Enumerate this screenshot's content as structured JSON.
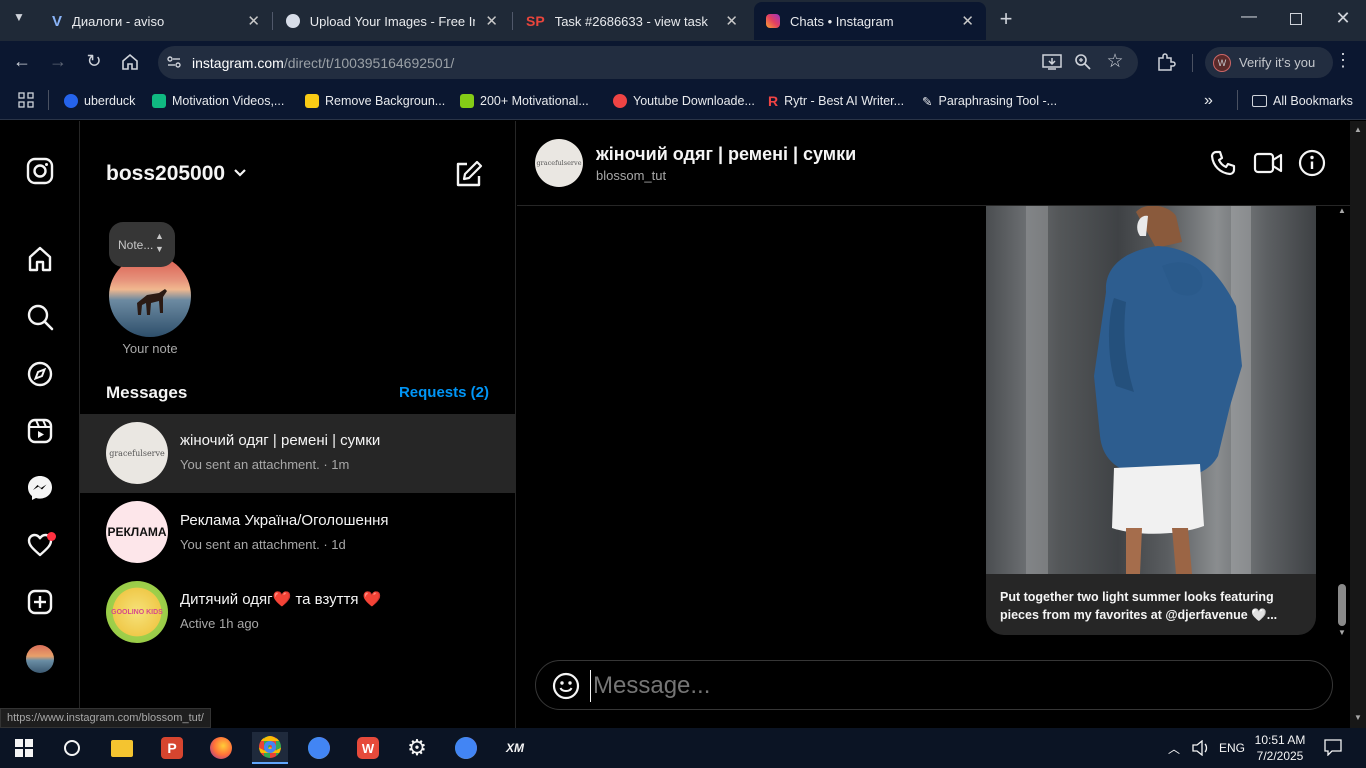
{
  "browser": {
    "tabs": [
      {
        "title": "Диалоги - aviso",
        "active": false
      },
      {
        "title": "Upload Your Images - Free Imag",
        "active": false
      },
      {
        "title": "Task #2686633 - view task",
        "active": false
      },
      {
        "title": "Chats • Instagram",
        "active": true
      }
    ],
    "url_host": "instagram.com",
    "url_path": "/direct/t/100395164692501/",
    "profile_button": "Verify it's you",
    "profile_initial": "W",
    "bookmarks": [
      "uberduck",
      "Motivation Videos,...",
      "Remove Backgroun...",
      "200+ Motivational...",
      "Youtube Downloade...",
      "Rytr - Best AI Writer...",
      "Paraphrasing Tool -..."
    ],
    "all_bookmarks": "All Bookmarks",
    "overflow": "»"
  },
  "sidebar": {
    "username": "boss205000",
    "note_label": "Note...",
    "your_note": "Your note",
    "messages_heading": "Messages",
    "requests": "Requests (2)",
    "conversations": [
      {
        "name": "жіночий одяг | ремені | сумки",
        "sub": "You sent an attachment. · 1m",
        "avatar_text": "gracefulserve"
      },
      {
        "name": "Реклама Україна/Оголошення",
        "sub": "You sent an attachment. · 1d",
        "avatar_text": "РЕКЛАМА"
      },
      {
        "name": "Дитячий одяг❤️ та взуття ❤️",
        "sub": "Active 1h ago",
        "avatar_text": "GOOLINO KIDS"
      }
    ]
  },
  "chat": {
    "title": "жіночий одяг | ремені | сумки",
    "handle": "blossom_tut",
    "header_avatar_text": "gracefulserve",
    "post_caption": "Put together two light summer looks featuring pieces from my favorites at @djerfavenue 🤍...",
    "message_placeholder": "Message..."
  },
  "status_url": "https://www.instagram.com/blossom_tut/",
  "taskbar": {
    "language": "ENG",
    "time": "10:51 AM",
    "date": "7/2/2025"
  },
  "colors": {
    "accent": "#0095f6",
    "selected_row": "#262626",
    "notification": "#ff3040"
  }
}
